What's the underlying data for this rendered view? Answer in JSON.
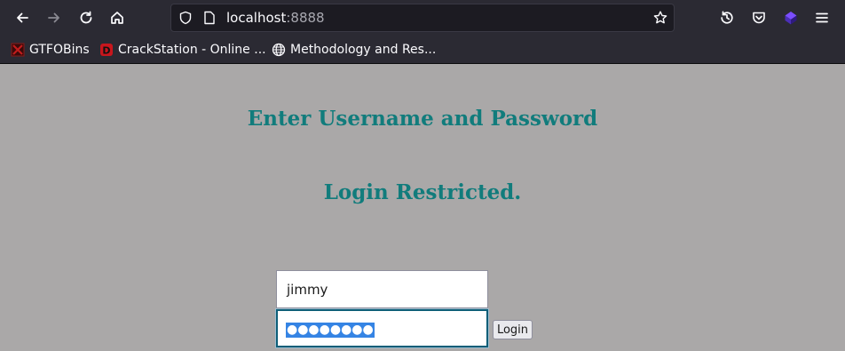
{
  "browser": {
    "url_host": "localhost",
    "url_port": ":8888",
    "bookmarks": [
      {
        "label": "GTFOBins",
        "icon": "gtfobins-favicon"
      },
      {
        "label": "CrackStation - Online ...",
        "icon": "crackstation-favicon"
      },
      {
        "label": "Methodology and Res...",
        "icon": "globe-icon"
      }
    ]
  },
  "page": {
    "heading": "Enter Username and Password",
    "message": "Login Restricted.",
    "username_value": "jimmy",
    "password_masked": "●●●●●●●●",
    "login_label": "Login"
  },
  "colors": {
    "page_background": "#aaa8a8",
    "heading_color": "#117c7c",
    "selection": "#3584e4",
    "chrome": "#2b2a33"
  }
}
